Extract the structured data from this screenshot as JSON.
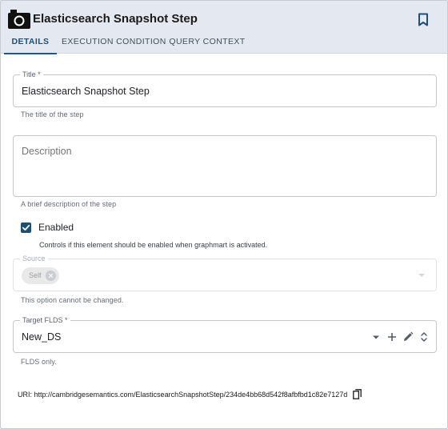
{
  "header": {
    "title": "Elasticsearch Snapshot Step",
    "icon": "camera-icon",
    "bookmark_icon": "bookmark-icon"
  },
  "tabs": [
    {
      "label": "DETAILS",
      "active": true
    },
    {
      "label": "EXECUTION CONDITION",
      "active": false
    },
    {
      "label": "QUERY CONTEXT",
      "active": false
    }
  ],
  "form": {
    "title": {
      "label": "Title *",
      "value": "Elasticsearch Snapshot Step",
      "hint": "The title of the step"
    },
    "description": {
      "placeholder": "Description",
      "value": "",
      "hint": "A brief description of the step"
    },
    "enabled": {
      "label": "Enabled",
      "checked": true,
      "hint": "Controls if this element should be enabled when graphmart is activated."
    },
    "source": {
      "label": "Source",
      "chip": "Self",
      "hint": "This option cannot be changed.",
      "disabled": true
    },
    "target": {
      "label": "Target FLDS *",
      "value": "New_DS",
      "hint": "FLDS only."
    }
  },
  "uri": {
    "text": "URI: http://cambridgesemantics.com/ElasticsearchSnapshotStep/234de4bb68d542f8afbfbd1c82e7127d",
    "copy_icon": "copy-icon"
  },
  "colors": {
    "header_bg": "#e4e9f1",
    "accent": "#1d4f73",
    "tab_active": "#1d4f78"
  }
}
